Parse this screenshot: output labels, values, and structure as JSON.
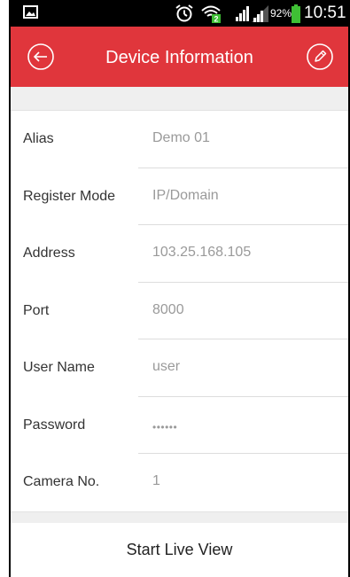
{
  "status_bar": {
    "battery_percent": "92%",
    "time": "10:51 AM",
    "notification_icon": "picture-icon",
    "icons": [
      "alarm-icon",
      "wifi-icon",
      "signal-icon",
      "battery-icon"
    ],
    "sim_badge": "2"
  },
  "header": {
    "title": "Device Information",
    "background_color": "#e0363c",
    "back_icon": "back-arrow-icon",
    "edit_icon": "pencil-icon"
  },
  "fields": [
    {
      "label": "Alias",
      "value": "Demo 01"
    },
    {
      "label": "Register Mode",
      "value": "IP/Domain"
    },
    {
      "label": "Address",
      "value": "103.25.168.105"
    },
    {
      "label": "Port",
      "value": "8000"
    },
    {
      "label": "User Name",
      "value": "user"
    },
    {
      "label": "Password",
      "value": "••••••"
    },
    {
      "label": "Camera No.",
      "value": "1"
    }
  ],
  "action": {
    "start_live_view_label": "Start Live View"
  }
}
